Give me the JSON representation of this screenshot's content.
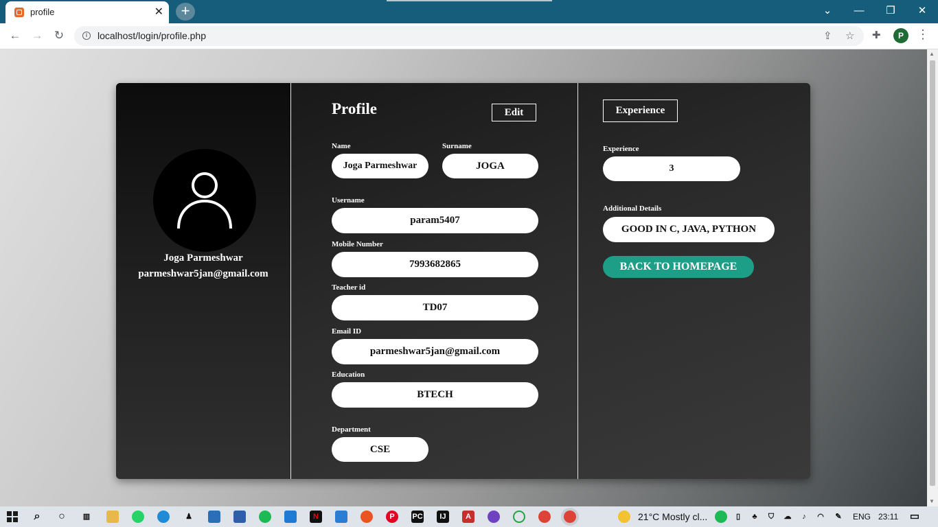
{
  "browser": {
    "tab_title": "profile",
    "url": "localhost/login/profile.php",
    "profile_initial": "P"
  },
  "profile": {
    "display_name": "Joga Parmeshwar",
    "display_email": "parmeshwar5jan@gmail.com",
    "heading": "Profile",
    "edit_label": "Edit",
    "fields": {
      "name": {
        "label": "Name",
        "value": "Joga Parmeshwar"
      },
      "surname": {
        "label": "Surname",
        "value": "JOGA"
      },
      "username": {
        "label": "Username",
        "value": "param5407"
      },
      "mobile": {
        "label": "Mobile Number",
        "value": "7993682865"
      },
      "teacher_id": {
        "label": "Teacher id",
        "value": "TD07"
      },
      "email": {
        "label": "Email ID",
        "value": "parmeshwar5jan@gmail.com"
      },
      "education": {
        "label": "Education",
        "value": "BTECH"
      },
      "department": {
        "label": "Department",
        "value": "CSE"
      }
    }
  },
  "experience": {
    "heading": "Experience",
    "experience_label": "Experience",
    "experience_value": "3",
    "details_label": "Additional Details",
    "details_value": "GOOD IN C, JAVA, PYTHON",
    "back_label": "BACK TO HOMEPAGE"
  },
  "taskbar": {
    "weather": "21°C  Mostly cl...",
    "language": "ENG",
    "time": "23:11"
  },
  "colors": {
    "chrome_bar": "#155d7a",
    "accent_green": "#1d9e86"
  }
}
